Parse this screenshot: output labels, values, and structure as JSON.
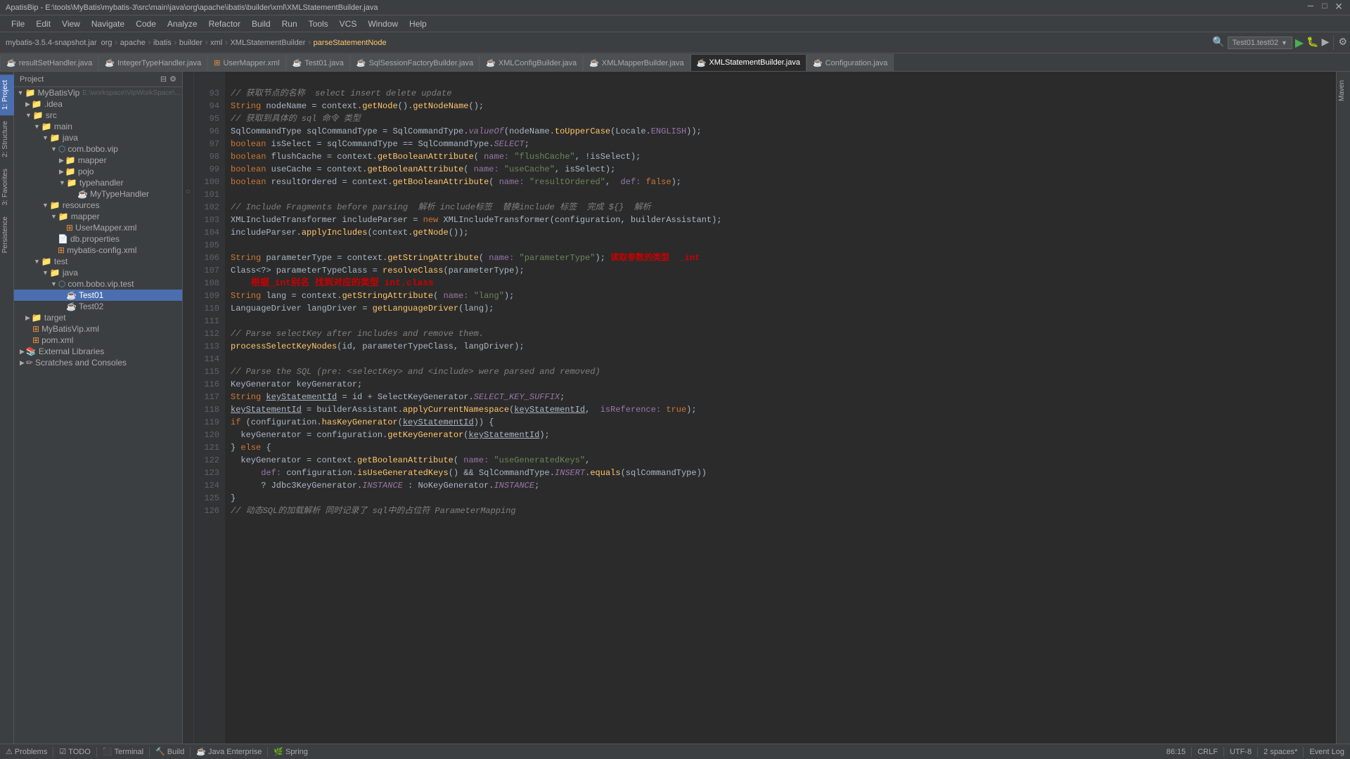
{
  "window": {
    "title": "ApatisBip - E:\\tools\\MyBatis\\mybatis-3\\src\\main\\java\\org\\apache\\ibatis\\builder\\xml\\XMLStatementBuilder.java"
  },
  "menubar": {
    "items": [
      "File",
      "Edit",
      "View",
      "Navigate",
      "Code",
      "Analyze",
      "Refactor",
      "Build",
      "Run",
      "Tools",
      "VCS",
      "Window",
      "Help"
    ]
  },
  "toolbar": {
    "project_label": "mybatis-3.5.4-snapshot.jar",
    "breadcrumb": [
      "org",
      "apache",
      "ibatis",
      "builder",
      "xml",
      "XMLStatementBuilder",
      "parseStatementNode"
    ],
    "run_config": "Test01.test02"
  },
  "file_tabs": [
    {
      "label": "resultSetHandler.java",
      "type": "java",
      "active": false
    },
    {
      "label": "IntegerTypeHandler.java",
      "type": "java",
      "active": false
    },
    {
      "label": "UserMapper.xml",
      "type": "xml",
      "active": false
    },
    {
      "label": "Test01.java",
      "type": "java",
      "active": false
    },
    {
      "label": "SqlSessionFactoryBuilder.java",
      "type": "java",
      "active": false
    },
    {
      "label": "XMLConfigBuilder.java",
      "type": "java",
      "active": false
    },
    {
      "label": "XMLMapperBuilder.java",
      "type": "java",
      "active": false
    },
    {
      "label": "XMLStatementBuilder.java",
      "type": "java",
      "active": true
    },
    {
      "label": "Configuration.java",
      "type": "java",
      "active": false
    }
  ],
  "sidebar": {
    "header": "Project",
    "items": [
      {
        "label": "MyBatisVip",
        "type": "root",
        "indent": 0,
        "expanded": true
      },
      {
        "label": ".idea",
        "type": "folder",
        "indent": 1,
        "expanded": false
      },
      {
        "label": "src",
        "type": "folder",
        "indent": 1,
        "expanded": true
      },
      {
        "label": "main",
        "type": "folder",
        "indent": 2,
        "expanded": true
      },
      {
        "label": "java",
        "type": "folder",
        "indent": 3,
        "expanded": true
      },
      {
        "label": "com.bobo.vip",
        "type": "package",
        "indent": 4,
        "expanded": true
      },
      {
        "label": "mapper",
        "type": "folder",
        "indent": 5,
        "expanded": false
      },
      {
        "label": "pojo",
        "type": "folder",
        "indent": 5,
        "expanded": false
      },
      {
        "label": "typehandler",
        "type": "folder",
        "indent": 5,
        "expanded": true
      },
      {
        "label": "MyTypeHandler",
        "type": "java",
        "indent": 6,
        "expanded": false
      },
      {
        "label": "resources",
        "type": "folder",
        "indent": 3,
        "expanded": true
      },
      {
        "label": "mapper",
        "type": "folder",
        "indent": 4,
        "expanded": false
      },
      {
        "label": "UserMapper.xml",
        "type": "xml",
        "indent": 5,
        "expanded": false
      },
      {
        "label": "db.properties",
        "type": "props",
        "indent": 4,
        "expanded": false
      },
      {
        "label": "mybatis-config.xml",
        "type": "xml",
        "indent": 4,
        "expanded": false
      },
      {
        "label": "test",
        "type": "folder",
        "indent": 2,
        "expanded": true
      },
      {
        "label": "java",
        "type": "folder",
        "indent": 3,
        "expanded": true
      },
      {
        "label": "com.bobo.vip.test",
        "type": "package",
        "indent": 4,
        "expanded": true
      },
      {
        "label": "Test01",
        "type": "java",
        "indent": 5,
        "expanded": false
      },
      {
        "label": "Test02",
        "type": "java",
        "indent": 5,
        "expanded": false
      },
      {
        "label": "target",
        "type": "folder",
        "indent": 1,
        "expanded": false
      },
      {
        "label": "MyBatisVip.xml",
        "type": "xml",
        "indent": 1,
        "expanded": false
      },
      {
        "label": "pom.xml",
        "type": "xml",
        "indent": 1,
        "expanded": false
      },
      {
        "label": "External Libraries",
        "type": "lib",
        "indent": 0,
        "expanded": false
      },
      {
        "label": "Scratches and Consoles",
        "type": "scratch",
        "indent": 0,
        "expanded": false
      }
    ]
  },
  "editor": {
    "lines": [
      {
        "num": 93,
        "content": "// 获取节点的名称  select insert delete update",
        "type": "comment"
      },
      {
        "num": 94,
        "content": "String nodeName = context.getNode().getNodeName();",
        "type": "code"
      },
      {
        "num": 95,
        "content": "// 获取到具体的 sql 命令 类型",
        "type": "comment"
      },
      {
        "num": 96,
        "content": "SqlCommandType sqlCommandType = SqlCommandType.valueOf(nodeName.toUpperCase(Locale.ENGLISH));",
        "type": "code"
      },
      {
        "num": 97,
        "content": "boolean isSelect = sqlCommandType == SqlCommandType.SELECT;",
        "type": "code"
      },
      {
        "num": 98,
        "content": "boolean flushCache = context.getBooleanAttribute( name: \"flushCache\", !isSelect);",
        "type": "code"
      },
      {
        "num": 99,
        "content": "boolean useCache = context.getBooleanAttribute( name: \"useCache\", isSelect);",
        "type": "code"
      },
      {
        "num": 100,
        "content": "boolean resultOrdered = context.getBooleanAttribute( name: \"resultOrdered\",  def: false);",
        "type": "code"
      },
      {
        "num": 101,
        "content": "",
        "type": "empty"
      },
      {
        "num": 102,
        "content": "// Include Fragments before parsing  解析 include标签  替换include 标签  完成 ${}  解析",
        "type": "comment"
      },
      {
        "num": 103,
        "content": "XMLIncludeTransformer includeParser = new XMLIncludeTransformer(configuration, builderAssistant);",
        "type": "code"
      },
      {
        "num": 104,
        "content": "includeParser.applyIncludes(context.getNode());",
        "type": "code"
      },
      {
        "num": 105,
        "content": "",
        "type": "empty"
      },
      {
        "num": 106,
        "content": "String parameterType = context.getStringAttribute( name: \"parameterType\"); 读取参数的类型  _int",
        "type": "annotation"
      },
      {
        "num": 107,
        "content": "Class<?> parameterTypeClass = resolveClass(parameterType);",
        "type": "code"
      },
      {
        "num": 108,
        "content": "    根据_int别名 找到对应的类型 int.class",
        "type": "annotation-cn"
      },
      {
        "num": 109,
        "content": "String lang = context.getStringAttribute( name: \"lang\");",
        "type": "code"
      },
      {
        "num": 110,
        "content": "LanguageDriver langDriver = getLanguageDriver(lang);",
        "type": "code"
      },
      {
        "num": 111,
        "content": "",
        "type": "empty"
      },
      {
        "num": 112,
        "content": "// Parse selectKey after includes and remove them.",
        "type": "comment"
      },
      {
        "num": 113,
        "content": "processSelectKeyNodes(id, parameterTypeClass, langDriver);",
        "type": "code"
      },
      {
        "num": 114,
        "content": "",
        "type": "empty"
      },
      {
        "num": 115,
        "content": "// Parse the SQL (pre: <selectKey> and <include> were parsed and removed)",
        "type": "comment"
      },
      {
        "num": 116,
        "content": "KeyGenerator keyGenerator;",
        "type": "code"
      },
      {
        "num": 117,
        "content": "String keyStatementId = id + SelectKeyGenerator.SELECT_KEY_SUFFIX;",
        "type": "code"
      },
      {
        "num": 118,
        "content": "keyStatementId = builderAssistant.applyCurrentNamespace(keyStatementId,  isReference: true);",
        "type": "code"
      },
      {
        "num": 119,
        "content": "if (configuration.hasKeyGenerator(keyStatementId)) {",
        "type": "code"
      },
      {
        "num": 120,
        "content": "  keyGenerator = configuration.getKeyGenerator(keyStatementId);",
        "type": "code"
      },
      {
        "num": 121,
        "content": "} else {",
        "type": "code"
      },
      {
        "num": 122,
        "content": "  keyGenerator = context.getBooleanAttribute( name: \"useGeneratedKeys\",",
        "type": "code"
      },
      {
        "num": 123,
        "content": "      def: configuration.isUseGeneratedKeys() && SqlCommandType.INSERT.equals(sqlCommandType)",
        "type": "code"
      },
      {
        "num": 124,
        "content": "      ? Jdbc3KeyGenerator.INSTANCE : NoKeyGenerator.INSTANCE;",
        "type": "code"
      },
      {
        "num": 125,
        "content": "}",
        "type": "code"
      },
      {
        "num": 126,
        "content": "// 动态SQL的加载解析 同时记录了 sql中的占位符 ParameterMapping",
        "type": "comment"
      }
    ]
  },
  "statusbar": {
    "problems": "Problems",
    "todo": "TODO",
    "terminal": "Terminal",
    "build": "Build",
    "java_enterprise": "Java Enterprise",
    "spring": "Spring",
    "position": "86:15",
    "line_ending": "CRLF",
    "encoding": "UTF-8",
    "indent": "2 spaces*",
    "event_log": "Event Log"
  },
  "left_vtabs": [
    "1: Project",
    "2: Structure",
    "3: Favorites",
    "Persistence"
  ],
  "right_vtabs": [
    "Maven"
  ]
}
